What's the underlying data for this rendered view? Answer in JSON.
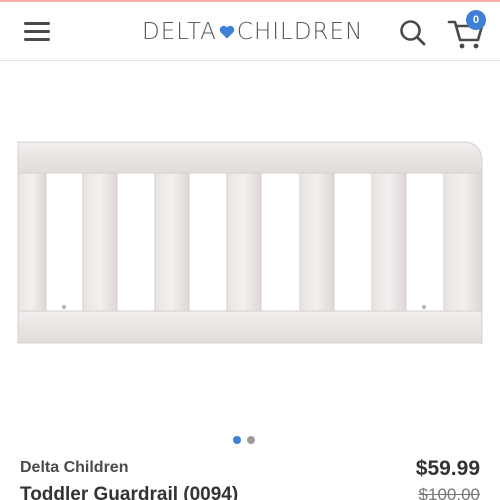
{
  "header": {
    "logo_left": "DELTA",
    "logo_heart": "♥",
    "logo_right": "CHILDREN",
    "cart_count": "0",
    "accent_color": "#3f7fd8",
    "icons": [
      "menu-icon",
      "search-icon",
      "cart-icon"
    ]
  },
  "gallery": {
    "image": "toddler-guardrail-white",
    "slide_count": 2,
    "active_slide": 1
  },
  "product": {
    "brand": "Delta Children",
    "name": "Toddler Guardrail (0094)",
    "price": "$59.99",
    "original_price": "$100.00"
  }
}
